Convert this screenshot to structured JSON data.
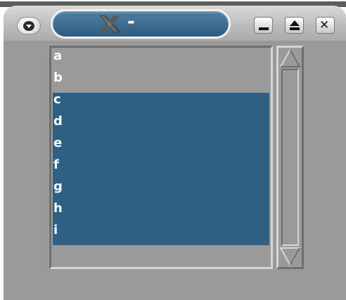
{
  "window": {
    "title": "-",
    "app_icon": "x-icon",
    "buttons": {
      "menu_icon": "chevron-down-icon",
      "minimize_icon": "minimize-icon",
      "maximize_icon": "maximize-icon",
      "close_glyph": "✕"
    }
  },
  "listbox": {
    "items": [
      {
        "label": "a",
        "selected": false
      },
      {
        "label": "b",
        "selected": false
      },
      {
        "label": "c",
        "selected": true
      },
      {
        "label": "d",
        "selected": true
      },
      {
        "label": "e",
        "selected": true
      },
      {
        "label": "f",
        "selected": true
      },
      {
        "label": "g",
        "selected": true
      },
      {
        "label": "h",
        "selected": true
      },
      {
        "label": "i",
        "selected": true
      }
    ]
  },
  "colors": {
    "selection": "#2f5f82",
    "title_pill": "#2e5c80",
    "background": "#9a9a9a",
    "text": "#ffffff"
  }
}
